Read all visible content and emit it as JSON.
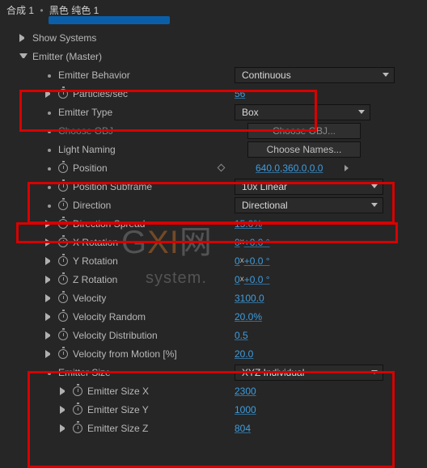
{
  "breadcrumb": {
    "a": "合成 1",
    "b": "黑色 纯色 1"
  },
  "sections": {
    "show_systems": "Show Systems",
    "emitter_master": "Emitter (Master)"
  },
  "rows": {
    "emitter_behavior": {
      "label": "Emitter Behavior",
      "value": "Continuous"
    },
    "particles_sec": {
      "label": "Particles/sec",
      "value": "56"
    },
    "emitter_type": {
      "label": "Emitter Type",
      "value": "Box"
    },
    "choose_obj": {
      "label": "Choose OBJ",
      "button": "Choose OBJ..."
    },
    "light_naming": {
      "label": "Light Naming",
      "button": "Choose Names..."
    },
    "position": {
      "label": "Position",
      "x": "640.0",
      "y": "360.0",
      "z": "0.0"
    },
    "position_subframe": {
      "label": "Position Subframe",
      "value": "10x Linear"
    },
    "direction": {
      "label": "Direction",
      "value": "Directional"
    },
    "direction_spread": {
      "label": "Direction Spread",
      "value": "15.0%"
    },
    "x_rotation": {
      "label": "X Rotation",
      "rev": "0",
      "deg": "+0.0 °"
    },
    "y_rotation": {
      "label": "Y Rotation",
      "rev": "0",
      "deg": "+0.0 °"
    },
    "z_rotation": {
      "label": "Z Rotation",
      "rev": "0",
      "deg": "+0.0 °"
    },
    "velocity": {
      "label": "Velocity",
      "value": "3100.0"
    },
    "velocity_random": {
      "label": "Velocity Random",
      "value": "20.0%"
    },
    "velocity_dist": {
      "label": "Velocity Distribution",
      "value": "0.5"
    },
    "velocity_motion": {
      "label": "Velocity from Motion [%]",
      "value": "20.0"
    },
    "emitter_size": {
      "label": "Emitter Size",
      "value": "XYZ Individual"
    },
    "emitter_size_x": {
      "label": "Emitter Size X",
      "value": "2300"
    },
    "emitter_size_y": {
      "label": "Emitter Size Y",
      "value": "1000"
    },
    "emitter_size_z": {
      "label": "Emitter Size Z",
      "value": "804"
    }
  },
  "watermark": {
    "prefix": "G",
    "mid": "XI",
    "suffix": "网",
    "sub": "system."
  }
}
